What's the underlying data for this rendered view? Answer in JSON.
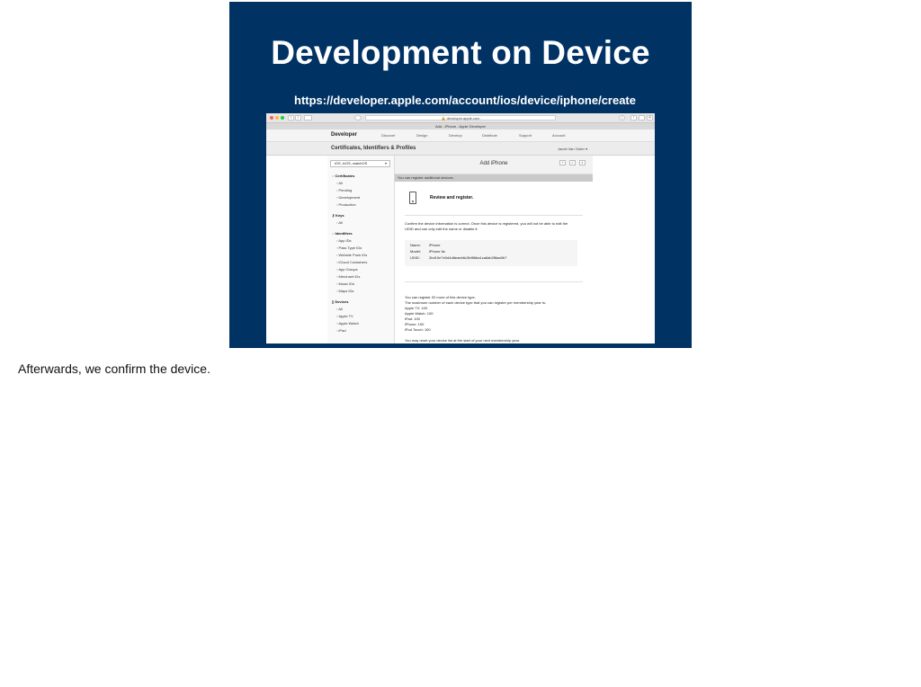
{
  "slide": {
    "title": "Development on Device",
    "url": "https://developer.apple.com/account/ios/device/iphone/create"
  },
  "browser": {
    "address": "developer.apple.com",
    "tab_title": "Add - iPhone - Apple Developer"
  },
  "devnav": {
    "brand": "Developer",
    "items": [
      "Discover",
      "Design",
      "Develop",
      "Distribute",
      "Support",
      "Account"
    ]
  },
  "certbar": {
    "title": "Certificates, Identifiers & Profiles",
    "user": "Jacob Van Order"
  },
  "sidebar": {
    "platform": "iOS, tvOS, watchOS",
    "sections": [
      {
        "label": "Certificates",
        "items": [
          "All",
          "Pending",
          "Development",
          "Production"
        ]
      },
      {
        "label": "Keys",
        "items": [
          "All"
        ]
      },
      {
        "label": "Identifiers",
        "items": [
          "App IDs",
          "Pass Type IDs",
          "Website Push IDs",
          "iCloud Containers",
          "App Groups",
          "Merchant IDs",
          "Music IDs",
          "Maps IDs"
        ]
      },
      {
        "label": "Devices",
        "items": [
          "All",
          "Apple TV",
          "Apple Watch",
          "iPad"
        ]
      }
    ]
  },
  "main": {
    "title": "Add iPhone",
    "notice": "You can register additional devices.",
    "review_title": "Review and register.",
    "confirm_text": [
      "Confirm the device information is correct. Once this device is registered, you will not be able to edit the",
      "UDID and can only edit the name or disable it."
    ],
    "fields": [
      {
        "key": "Name:",
        "value": "iPhone"
      },
      {
        "key": "Model:",
        "value": "iPhone 6s"
      },
      {
        "key": "UDID:",
        "value": "2bd19e7e0d4d8eaeb6c3bf86ba1ca6ab2f8aa0b7"
      }
    ],
    "limits": [
      "You can register 92 more of this device type.",
      "The maximum number of each device type that you can register per membership year is:",
      "Apple TV: 100",
      "Apple Watch: 100",
      "iPad: 100",
      "iPhone: 100",
      "iPod Touch: 100"
    ],
    "reset_text": "You may reset your device list at the start of your next membership year."
  },
  "caption": "Afterwards, we confirm the device."
}
